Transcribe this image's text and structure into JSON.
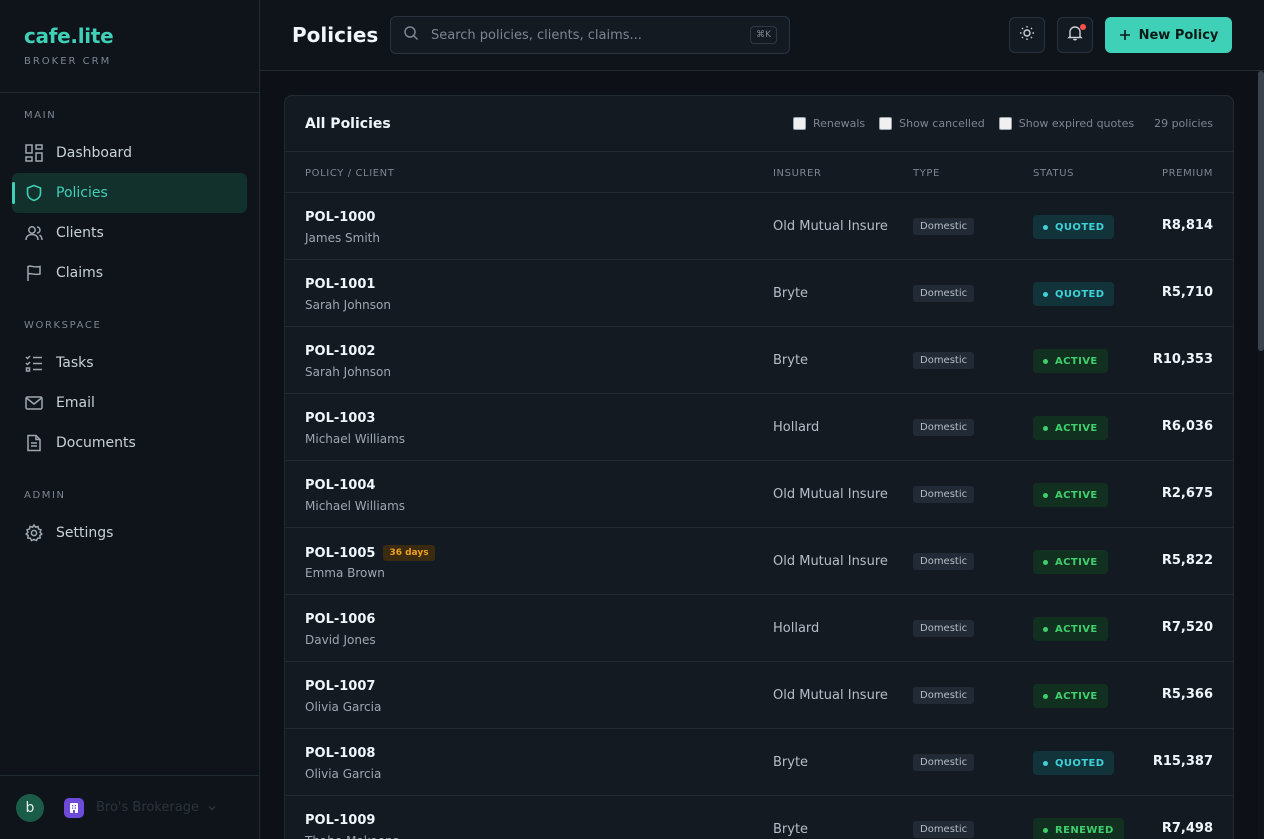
{
  "brand": {
    "name": "cafe.lite",
    "subtitle": "BROKER CRM"
  },
  "sidebar": {
    "sections": [
      {
        "heading": "MAIN",
        "items": [
          {
            "label": "Dashboard",
            "icon": "dashboard-icon"
          },
          {
            "label": "Policies",
            "icon": "shield-icon",
            "active": true
          },
          {
            "label": "Clients",
            "icon": "users-icon"
          },
          {
            "label": "Claims",
            "icon": "flag-icon"
          }
        ]
      },
      {
        "heading": "WORKSPACE",
        "items": [
          {
            "label": "Tasks",
            "icon": "tasks-icon"
          },
          {
            "label": "Email",
            "icon": "mail-icon"
          },
          {
            "label": "Documents",
            "icon": "document-icon"
          }
        ]
      },
      {
        "heading": "ADMIN",
        "items": [
          {
            "label": "Settings",
            "icon": "gear-icon"
          }
        ]
      }
    ],
    "footer": {
      "avatar_initial": "b",
      "org_name": "Bro's Brokerage"
    }
  },
  "topbar": {
    "title": "Policies",
    "search_placeholder": "Search policies, clients, claims...",
    "shortcut": "⌘K",
    "new_button": "New Policy"
  },
  "card": {
    "title": "All Policies",
    "filters": [
      "Renewals",
      "Show cancelled",
      "Show expired quotes"
    ],
    "count": "29 policies",
    "columns": [
      "POLICY / CLIENT",
      "INSURER",
      "TYPE",
      "STATUS",
      "PREMIUM"
    ],
    "rows": [
      {
        "id": "POL-1000",
        "client": "James Smith",
        "insurer": "Old Mutual Insure",
        "type": "Domestic",
        "status": "QUOTED",
        "premium": "R8,814"
      },
      {
        "id": "POL-1001",
        "client": "Sarah Johnson",
        "insurer": "Bryte",
        "type": "Domestic",
        "status": "QUOTED",
        "premium": "R5,710"
      },
      {
        "id": "POL-1002",
        "client": "Sarah Johnson",
        "insurer": "Bryte",
        "type": "Domestic",
        "status": "ACTIVE",
        "premium": "R10,353"
      },
      {
        "id": "POL-1003",
        "client": "Michael Williams",
        "insurer": "Hollard",
        "type": "Domestic",
        "status": "ACTIVE",
        "premium": "R6,036"
      },
      {
        "id": "POL-1004",
        "client": "Michael Williams",
        "insurer": "Old Mutual Insure",
        "type": "Domestic",
        "status": "ACTIVE",
        "premium": "R2,675"
      },
      {
        "id": "POL-1005",
        "client": "Emma Brown",
        "insurer": "Old Mutual Insure",
        "type": "Domestic",
        "status": "ACTIVE",
        "premium": "R5,822",
        "badge": "36 days"
      },
      {
        "id": "POL-1006",
        "client": "David Jones",
        "insurer": "Hollard",
        "type": "Domestic",
        "status": "ACTIVE",
        "premium": "R7,520"
      },
      {
        "id": "POL-1007",
        "client": "Olivia Garcia",
        "insurer": "Old Mutual Insure",
        "type": "Domestic",
        "status": "ACTIVE",
        "premium": "R5,366"
      },
      {
        "id": "POL-1008",
        "client": "Olivia Garcia",
        "insurer": "Bryte",
        "type": "Domestic",
        "status": "QUOTED",
        "premium": "R15,387"
      },
      {
        "id": "POL-1009",
        "client": "Thabo Mokoena",
        "insurer": "Bryte",
        "type": "Domestic",
        "status": "RENEWED",
        "premium": "R7,498"
      }
    ]
  },
  "colors": {
    "accent": "#3fd1b8",
    "quoted": "#3fd1d8",
    "active": "#3fcf6e",
    "warning": "#f0a020"
  }
}
